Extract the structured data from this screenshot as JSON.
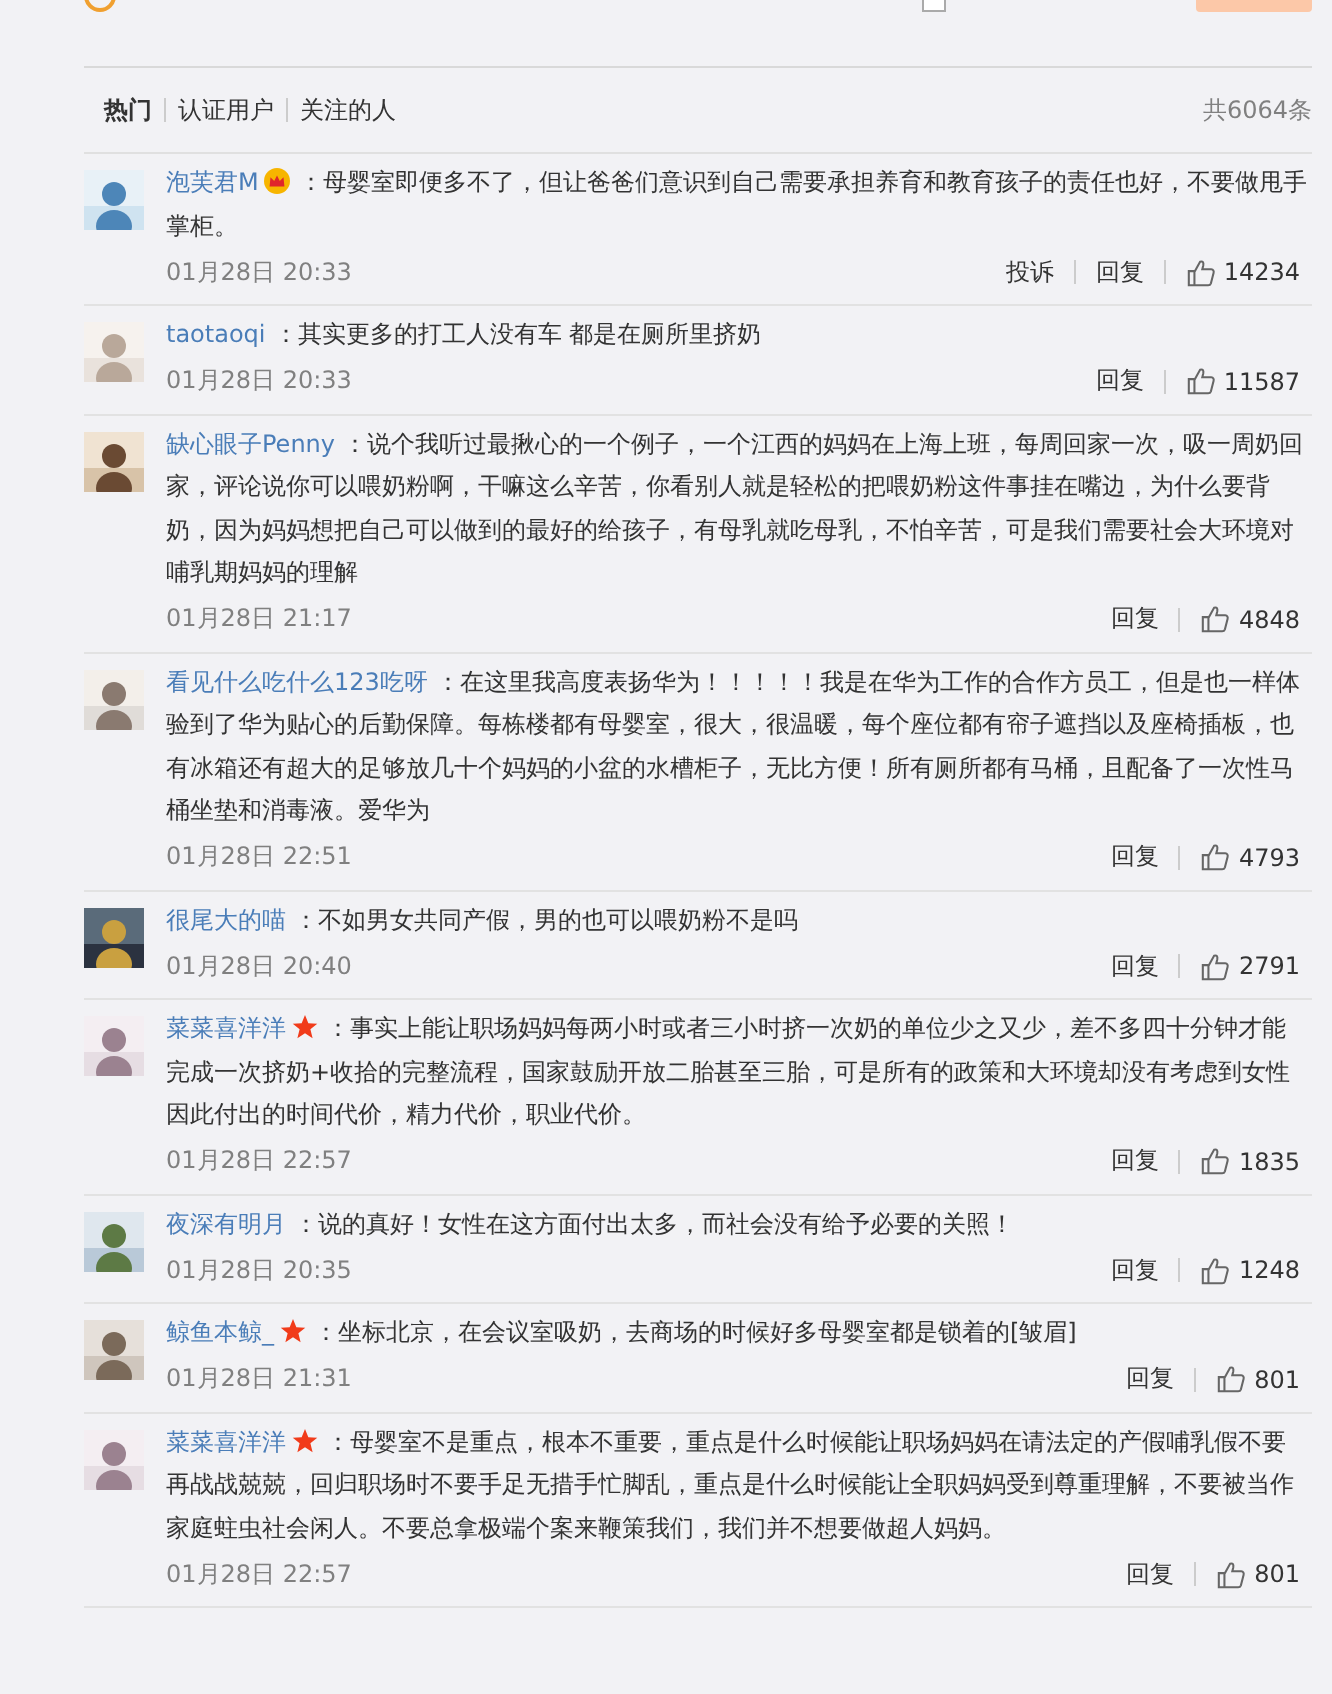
{
  "composer": {
    "checked": false
  },
  "tabs": [
    {
      "label": "热门",
      "selected": true
    },
    {
      "label": "认证用户",
      "selected": false
    },
    {
      "label": "关注的人",
      "selected": false
    }
  ],
  "total": "共6064条",
  "comments": [
    {
      "user": "泡芙君M",
      "kind": "crowned",
      "text": "：母婴室即便多不了，但让爸爸们意识到自己需要承担养育和教育孩子的责任也好，不要做甩手掌柜。",
      "time": "01月28日 20:33",
      "actions": [
        "投诉",
        "回复"
      ],
      "likes": "14234"
    },
    {
      "user": "taotaoqi",
      "kind": "plain",
      "text": "：其实更多的打工人没有车 都是在厕所里挤奶",
      "time": "01月28日 20:33",
      "actions": [
        "回复"
      ],
      "likes": "11587"
    },
    {
      "user": "缺心眼子Penny",
      "kind": "plain",
      "text": "：说个我听过最揪心的一个例子，一个江西的妈妈在上海上班，每周回家一次，吸一周奶回家，评论说你可以喂奶粉啊，干嘛这么辛苦，你看别人就是轻松的把喂奶粉这件事挂在嘴边，为什么要背奶，因为妈妈想把自己可以做到的最好的给孩子，有母乳就吃母乳，不怕辛苦，可是我们需要社会大环境对哺乳期妈妈的理解",
      "time": "01月28日 21:17",
      "actions": [
        "回复"
      ],
      "likes": "4848"
    },
    {
      "user": "看见什么吃什么123吃呀",
      "kind": "plain",
      "text": "：在这里我高度表扬华为！！！！！我是在华为工作的合作方员工，但是也一样体验到了华为贴心的后勤保障。每栋楼都有母婴室，很大，很温暖，每个座位都有帘子遮挡以及座椅插板，也有冰箱还有超大的足够放几十个妈妈的小盆的水槽柜子，无比方便！所有厕所都有马桶，且配备了一次性马桶坐垫和消毒液。爱华为",
      "time": "01月28日 22:51",
      "actions": [
        "回复"
      ],
      "likes": "4793"
    },
    {
      "user": "很尾大的喵",
      "kind": "plain",
      "text": "：不如男女共同产假，男的也可以喂奶粉不是吗",
      "time": "01月28日 20:40",
      "actions": [
        "回复"
      ],
      "likes": "2791"
    },
    {
      "user": "菜菜喜洋洋",
      "kind": "starred",
      "text": "：事实上能让职场妈妈每两小时或者三小时挤一次奶的单位少之又少，差不多四十分钟才能完成一次挤奶+收拾的完整流程，国家鼓励开放二胎甚至三胎，可是所有的政策和大环境却没有考虑到女性因此付出的时间代价，精力代价，职业代价。",
      "time": "01月28日 22:57",
      "actions": [
        "回复"
      ],
      "likes": "1835"
    },
    {
      "user": "夜深有明月",
      "kind": "plain",
      "text": "：说的真好！女性在这方面付出太多，而社会没有给予必要的关照！",
      "time": "01月28日 20:35",
      "actions": [
        "回复"
      ],
      "likes": "1248"
    },
    {
      "user": "鲸鱼本鲸_",
      "kind": "starred",
      "text": "：坐标北京，在会议室吸奶，去商场的时候好多母婴室都是锁着的[皱眉]",
      "time": "01月28日 21:31",
      "actions": [
        "回复"
      ],
      "likes": "801"
    },
    {
      "user": "菜菜喜洋洋",
      "kind": "starred",
      "text": "：母婴室不是重点，根本不重要，重点是什么时候能让职场妈妈在请法定的产假哺乳假不要再战战兢兢，回归职场时不要手足无措手忙脚乱，重点是什么时候能让全职妈妈受到尊重理解，不要被当作家庭蛀虫社会闲人。不要总拿极端个案来鞭策我们，我们并不想要做超人妈妈。",
      "time": "01月28日 22:57",
      "actions": [
        "回复"
      ],
      "likes": "801"
    }
  ]
}
